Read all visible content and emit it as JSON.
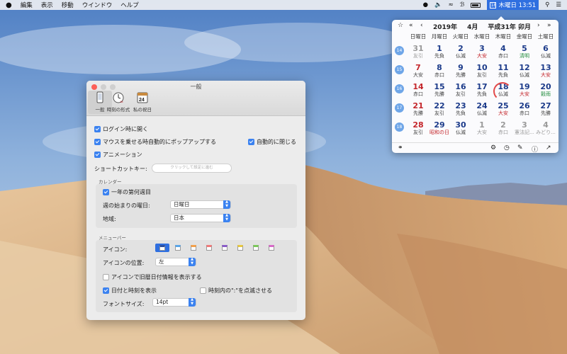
{
  "menubar": {
    "items": [
      "編集",
      "表示",
      "移動",
      "ウインドウ",
      "ヘルプ"
    ],
    "clock": "木曜日 13:51",
    "cal_icon": "18"
  },
  "calendar": {
    "year": "2019年",
    "month": "4月",
    "era": "平成31年 卯月",
    "weekdays": [
      "日曜日",
      "月曜日",
      "火曜日",
      "水曜日",
      "木曜日",
      "金曜日",
      "土曜日"
    ],
    "weeks": [
      {
        "no": "14",
        "days": [
          {
            "d": "31",
            "r": "友引",
            "t": "mut"
          },
          {
            "d": "1",
            "r": "先負"
          },
          {
            "d": "2",
            "r": "仏滅"
          },
          {
            "d": "3",
            "r": "大安",
            "t": "red"
          },
          {
            "d": "4",
            "r": "赤口"
          },
          {
            "d": "5",
            "r": "清明",
            "t": "grn"
          },
          {
            "d": "6",
            "r": "仏滅",
            "t": "sat"
          }
        ]
      },
      {
        "no": "15",
        "days": [
          {
            "d": "7",
            "r": "大安",
            "t": "sun"
          },
          {
            "d": "8",
            "r": "赤口"
          },
          {
            "d": "9",
            "r": "先勝"
          },
          {
            "d": "10",
            "r": "友引"
          },
          {
            "d": "11",
            "r": "先負"
          },
          {
            "d": "12",
            "r": "仏滅"
          },
          {
            "d": "13",
            "r": "大安",
            "t": "red"
          }
        ]
      },
      {
        "no": "16",
        "days": [
          {
            "d": "14",
            "r": "赤口",
            "t": "sun"
          },
          {
            "d": "15",
            "r": "先勝"
          },
          {
            "d": "16",
            "r": "友引"
          },
          {
            "d": "17",
            "r": "先負"
          },
          {
            "d": "18",
            "r": "仏滅"
          },
          {
            "d": "19",
            "r": "大安",
            "t": "red"
          },
          {
            "d": "20",
            "r": "穀雨",
            "t": "grn"
          }
        ]
      },
      {
        "no": "17",
        "days": [
          {
            "d": "21",
            "r": "先勝",
            "t": "sun"
          },
          {
            "d": "22",
            "r": "友引"
          },
          {
            "d": "23",
            "r": "先負"
          },
          {
            "d": "24",
            "r": "仏滅"
          },
          {
            "d": "25",
            "r": "大安",
            "t": "red"
          },
          {
            "d": "26",
            "r": "赤口"
          },
          {
            "d": "27",
            "r": "先勝"
          }
        ]
      },
      {
        "no": "18",
        "days": [
          {
            "d": "28",
            "r": "友引",
            "t": "sun"
          },
          {
            "d": "29",
            "r": "昭和の日",
            "t": "sunred"
          },
          {
            "d": "30",
            "r": "仏滅"
          },
          {
            "d": "1",
            "r": "大安",
            "t": "mut"
          },
          {
            "d": "2",
            "r": "赤口",
            "t": "mut"
          },
          {
            "d": "3",
            "r": "憲法記...",
            "t": "mut"
          },
          {
            "d": "4",
            "r": "みどり...",
            "t": "mut"
          }
        ]
      }
    ]
  },
  "prefs": {
    "title": "一般",
    "tabs": [
      "一般",
      "時刻の形式",
      "私の祝日"
    ],
    "tab_icon_text": "24",
    "clock_icon_badge": "18",
    "login": "ログイン時に開く",
    "hover": "マウスを乗せる時自動的にポップアップする",
    "autoclose": "自動的に閉じる",
    "animation": "アニメーション",
    "shortcut_label": "ショートカットキー:",
    "shortcut_ph": "クリックして設定に進む",
    "calendar_section": "カレンダー",
    "weekno": "一年の第何週目",
    "weekstart_label": "週の始まりの曜日:",
    "weekstart_val": "日曜日",
    "region_label": "地域:",
    "region_val": "日本",
    "menubar_section": "メニューバー",
    "icon_label": "アイコン:",
    "iconpos_label": "アイコンの位置:",
    "iconpos_val": "左",
    "oldcal": "アイコンで旧暦日付情報を表示する",
    "datetime": "日付と時刻を表示",
    "blink": "時刻内の\":\"を点滅させる",
    "fontsize_label": "フォントサイズ:",
    "fontsize_val": "14pt",
    "icon_colors": [
      "#2a4ea0",
      "#5aa6e8",
      "#f4a14a",
      "#f07a7a",
      "#8a5cc8",
      "#e8c840",
      "#7bc85a",
      "#d86ac8"
    ]
  }
}
